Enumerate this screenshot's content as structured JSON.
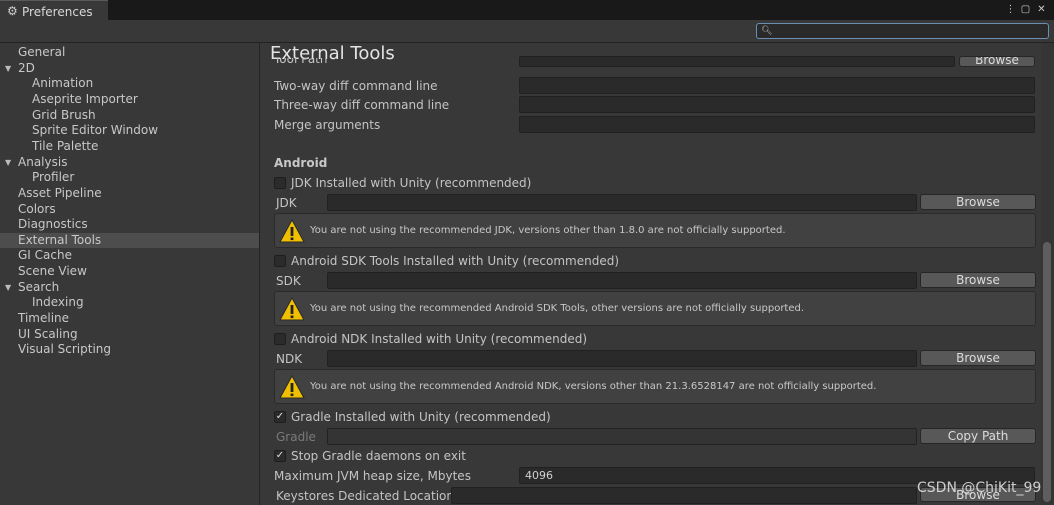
{
  "window": {
    "tab_title": "Preferences",
    "search": {
      "placeholder": "",
      "value": ""
    }
  },
  "sidebar": {
    "items": [
      {
        "label": "General",
        "indent": 0,
        "arrow": ""
      },
      {
        "label": "2D",
        "indent": 0,
        "arrow": "▼"
      },
      {
        "label": "Animation",
        "indent": 1,
        "arrow": ""
      },
      {
        "label": "Aseprite Importer",
        "indent": 1,
        "arrow": ""
      },
      {
        "label": "Grid Brush",
        "indent": 1,
        "arrow": ""
      },
      {
        "label": "Sprite Editor Window",
        "indent": 1,
        "arrow": ""
      },
      {
        "label": "Tile Palette",
        "indent": 1,
        "arrow": ""
      },
      {
        "label": "Analysis",
        "indent": 0,
        "arrow": "▼"
      },
      {
        "label": "Profiler",
        "indent": 1,
        "arrow": ""
      },
      {
        "label": "Asset Pipeline",
        "indent": 0,
        "arrow": ""
      },
      {
        "label": "Colors",
        "indent": 0,
        "arrow": ""
      },
      {
        "label": "Diagnostics",
        "indent": 0,
        "arrow": ""
      },
      {
        "label": "External Tools",
        "indent": 0,
        "arrow": "",
        "selected": true
      },
      {
        "label": "GI Cache",
        "indent": 0,
        "arrow": ""
      },
      {
        "label": "Scene View",
        "indent": 0,
        "arrow": ""
      },
      {
        "label": "Search",
        "indent": 0,
        "arrow": "▼"
      },
      {
        "label": "Indexing",
        "indent": 1,
        "arrow": ""
      },
      {
        "label": "Timeline",
        "indent": 0,
        "arrow": ""
      },
      {
        "label": "UI Scaling",
        "indent": 0,
        "arrow": ""
      },
      {
        "label": "Visual Scripting",
        "indent": 0,
        "arrow": ""
      }
    ]
  },
  "main": {
    "title": "External Tools",
    "tool_path_label": "Tool Path",
    "browse_top_label": "Browse",
    "two_way_label": "Two-way diff command line",
    "three_way_label": "Three-way diff command line",
    "merge_label": "Merge arguments",
    "android_header": "Android",
    "jdk": {
      "checkbox_label": "JDK Installed with Unity (recommended)",
      "checked": false,
      "label": "JDK",
      "path": "",
      "browse": "Browse",
      "warning": "You are not using the recommended JDK, versions other than 1.8.0 are not officially supported."
    },
    "sdk": {
      "checkbox_label": "Android SDK Tools Installed with Unity (recommended)",
      "checked": false,
      "label": "SDK",
      "path": "",
      "browse": "Browse",
      "warning": "You are not using the recommended Android SDK Tools, other versions are not officially supported."
    },
    "ndk": {
      "checkbox_label": "Android NDK Installed with Unity (recommended)",
      "checked": false,
      "label": "NDK",
      "path": "",
      "browse": "Browse",
      "warning": "You are not using the recommended Android NDK, versions other than 21.3.6528147 are not officially supported."
    },
    "gradle": {
      "checkbox_label": "Gradle Installed with Unity (recommended)",
      "checked": true,
      "label": "Gradle",
      "path": "",
      "copy_path": "Copy Path"
    },
    "stop_gradle": {
      "label": "Stop Gradle daemons on exit",
      "checked": true
    },
    "jvm_heap": {
      "label": "Maximum JVM heap size, Mbytes",
      "value": "4096"
    },
    "keystores": {
      "label": "Keystores Dedicated Location",
      "path": "",
      "browse": "Browse"
    }
  },
  "watermark": "CSDN @ChiKit_99",
  "colors": {
    "background": "#383838",
    "selected": "#4d4d4d",
    "warning": "#f0c000"
  }
}
